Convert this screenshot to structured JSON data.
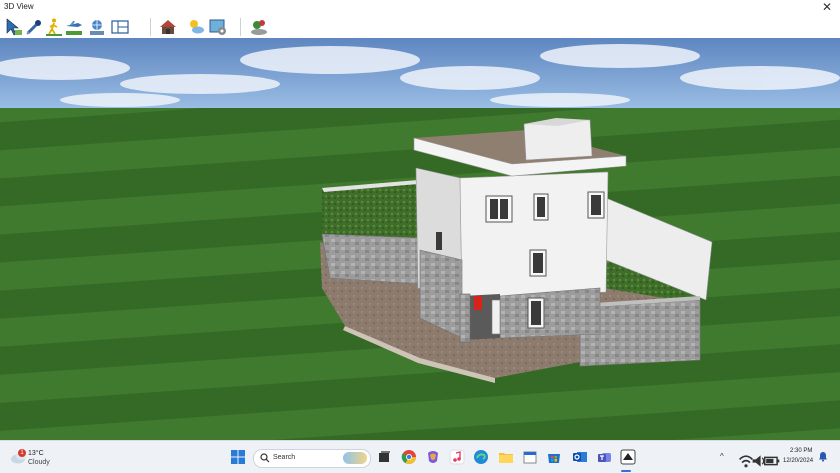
{
  "window": {
    "title": "3D View",
    "close_glyph": "✕"
  },
  "toolbar": {
    "tools": [
      {
        "name": "select-arrow-icon"
      },
      {
        "name": "eyedropper-icon"
      },
      {
        "name": "walk-person-icon"
      },
      {
        "name": "aerial-camera-icon"
      },
      {
        "name": "globe-tool-icon"
      },
      {
        "name": "window-layout-icon"
      },
      {
        "name": "house-view-icon"
      },
      {
        "name": "sun-weather-icon"
      },
      {
        "name": "render-settings-icon"
      },
      {
        "name": "landscape-plants-icon"
      }
    ]
  },
  "taskbar": {
    "weather": {
      "temp": "13°C",
      "condition": "Cloudy",
      "badge": "1"
    },
    "search_label": "Search",
    "apps": [
      "windows-start-icon",
      "task-view-icon",
      "chrome-icon",
      "copilot-icon",
      "itunes-icon",
      "edge-icon",
      "file-explorer-icon",
      "calendar-icon",
      "microsoft-store-icon",
      "outlook-icon",
      "teams-icon",
      "home-design-app-icon"
    ],
    "tray": {
      "chevron": "^",
      "time": "2:30 PM",
      "date": "12/20/2024"
    }
  }
}
